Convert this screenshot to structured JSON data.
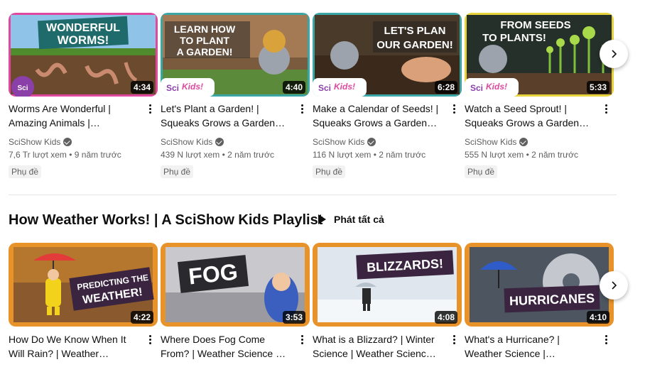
{
  "row1": {
    "videos": [
      {
        "title": "Worms Are Wonderful | Amazing Animals | Backyar…",
        "channel": "SciShow Kids",
        "meta": "7,6 Tr lượt xem • 9 năm trước",
        "badge": "Phụ đề",
        "duration": "4:34",
        "thumb_text": "WONDERFUL WORMS!"
      },
      {
        "title": "Let's Plant a Garden! | Squeaks Grows a Garden! |…",
        "channel": "SciShow Kids",
        "meta": "439 N lượt xem • 2 năm trước",
        "badge": "Phụ đề",
        "duration": "4:40",
        "thumb_text": "LEARN HOW TO PLANT A GARDEN!",
        "logo": "Kids!"
      },
      {
        "title": "Make a Calendar of Seeds! | Squeaks Grows a Garden! |…",
        "channel": "SciShow Kids",
        "meta": "116 N lượt xem • 2 năm trước",
        "badge": "Phụ đề",
        "duration": "6:28",
        "thumb_text": "LET'S PLAN OUR GARDEN!",
        "logo": "Kids!"
      },
      {
        "title": "Watch a Seed Sprout! | Squeaks Grows a Garden! |…",
        "channel": "SciShow Kids",
        "meta": "555 N lượt xem • 2 năm trước",
        "badge": "Phụ đề",
        "duration": "5:33",
        "thumb_text": "FROM SEEDS TO PLANTS!",
        "logo": "Kids!"
      }
    ]
  },
  "shelf": {
    "title": "How Weather Works! | A SciShow Kids Playlist",
    "play_all": "Phát tất cả"
  },
  "row2": {
    "videos": [
      {
        "title": "How Do We Know When It Will Rain? | Weather Scienc…",
        "duration": "4:22",
        "thumb_text": "PREDICTING THE WEATHER!"
      },
      {
        "title": "Where Does Fog Come From? | Weather Science | SciSho…",
        "duration": "3:53",
        "thumb_text": "FOG"
      },
      {
        "title": "What is a Blizzard? | Winter Science | Weather Science |…",
        "duration": "4:08",
        "thumb_text": "BLIZZARDS!"
      },
      {
        "title": "What's a Hurricane? | Weather Science | SciShow…",
        "duration": "4:10",
        "thumb_text": "HURRICANES"
      }
    ]
  },
  "icons": {
    "next": "chevron-right-icon",
    "more": "more-vert-icon",
    "verified": "verified-check-icon",
    "play": "play-icon"
  },
  "colors": {
    "brand_purple": "#8b3fa8",
    "orange_frame": "#e8932a",
    "pink_frame": "#e0479e",
    "teal_frame": "#3ba6a6",
    "yellow_frame": "#e6d23a"
  }
}
